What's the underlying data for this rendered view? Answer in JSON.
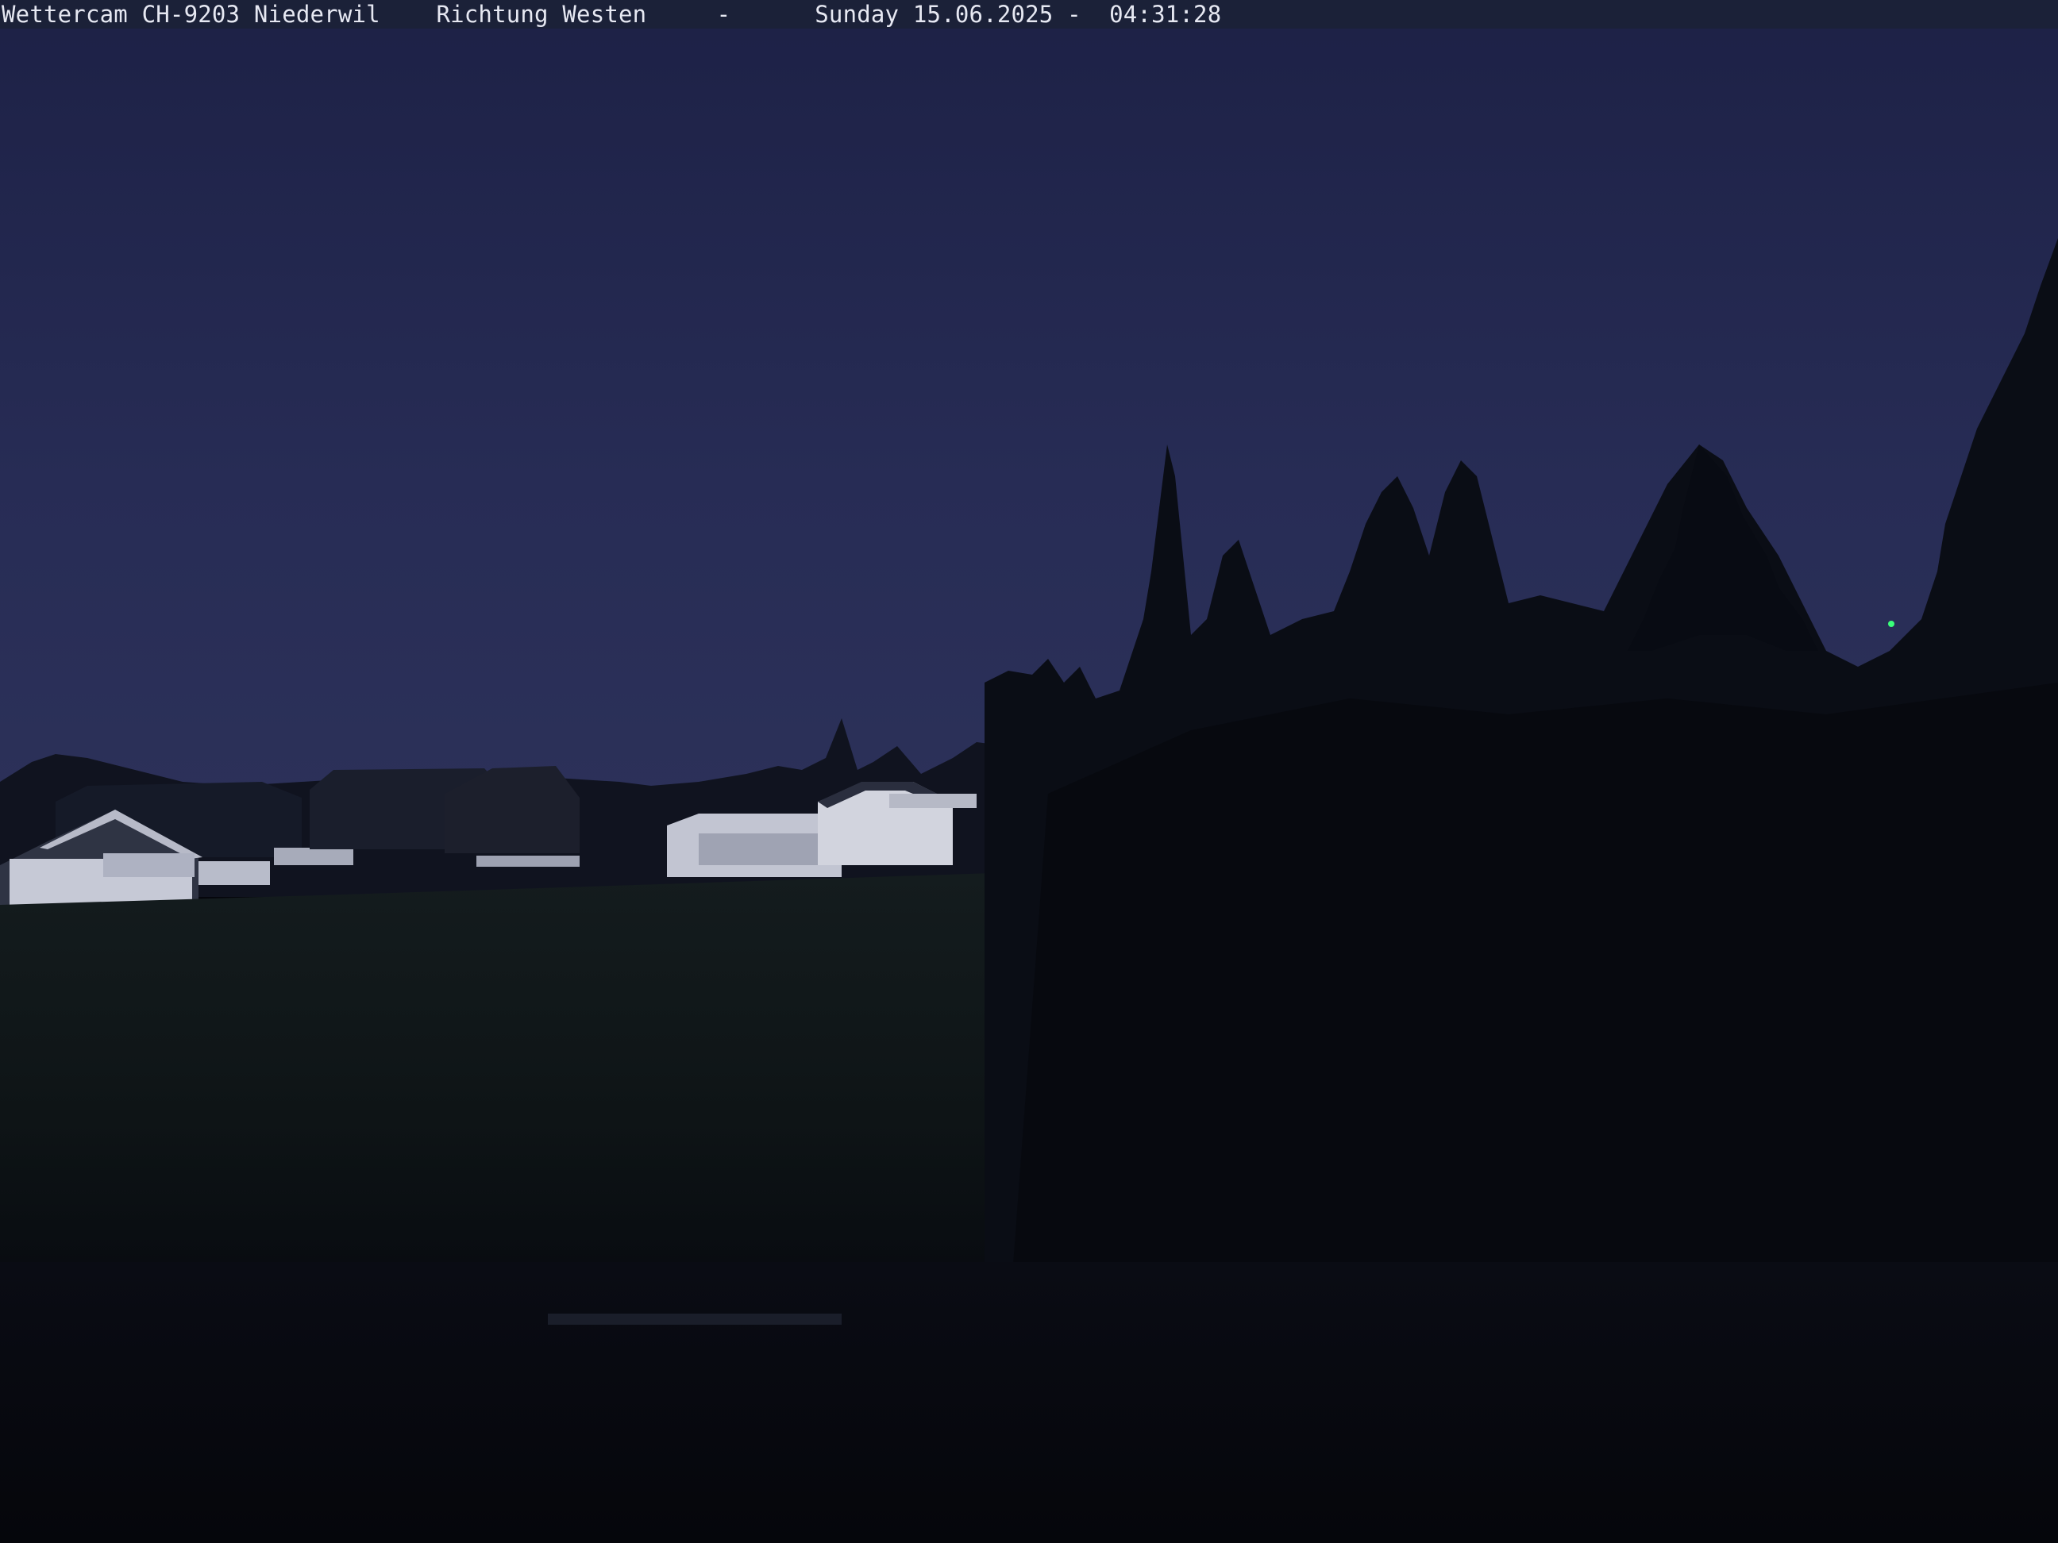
{
  "overlay": {
    "caption": "Wettercam CH-9203 Niederwil    Richtung Westen     -      Sunday 15.06.2025 -  04:31:28"
  },
  "colors": {
    "sky_top": "#1d2146",
    "sky_horizon": "#2b3059",
    "field": "#121a1c",
    "foreground": "#060810",
    "tree_silhouette": "#0a0d14",
    "house_roof_light": "#c8cad6",
    "overlay_bar": "#1b2138",
    "status_light": "#3aff7a"
  }
}
